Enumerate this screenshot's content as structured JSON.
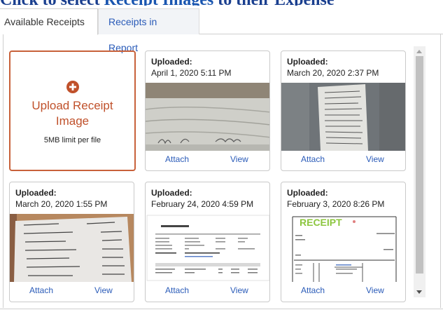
{
  "heading": {
    "part1": "Click to select ",
    "part2": "Receipt Images",
    "part3": " to their Expense"
  },
  "tabs": [
    {
      "label": "Available Receipts"
    },
    {
      "label": "Receipts in Report"
    }
  ],
  "upload": {
    "label": "Upload Receipt Image",
    "limit": "5MB limit per file"
  },
  "receipts": [
    {
      "uploaded_label": "Uploaded:",
      "date": "April 1, 2020 5:11 PM",
      "attach": "Attach",
      "view": "View"
    },
    {
      "uploaded_label": "Uploaded:",
      "date": "March 20, 2020 2:37 PM",
      "attach": "Attach",
      "view": "View"
    },
    {
      "uploaded_label": "Uploaded:",
      "date": "March 20, 2020 1:55 PM",
      "attach": "Attach",
      "view": "View"
    },
    {
      "uploaded_label": "Uploaded:",
      "date": "February 24, 2020 4:59 PM",
      "attach": "Attach",
      "view": "View"
    },
    {
      "uploaded_label": "Uploaded:",
      "date": "February 3, 2020 8:26 PM",
      "attach": "Attach",
      "view": "View"
    }
  ],
  "receipt_image_text": {
    "receipt_word": "RECEIPT"
  },
  "colors": {
    "accent": "#c0512b",
    "link": "#2a5bb8",
    "border": "#c9c9c9"
  }
}
